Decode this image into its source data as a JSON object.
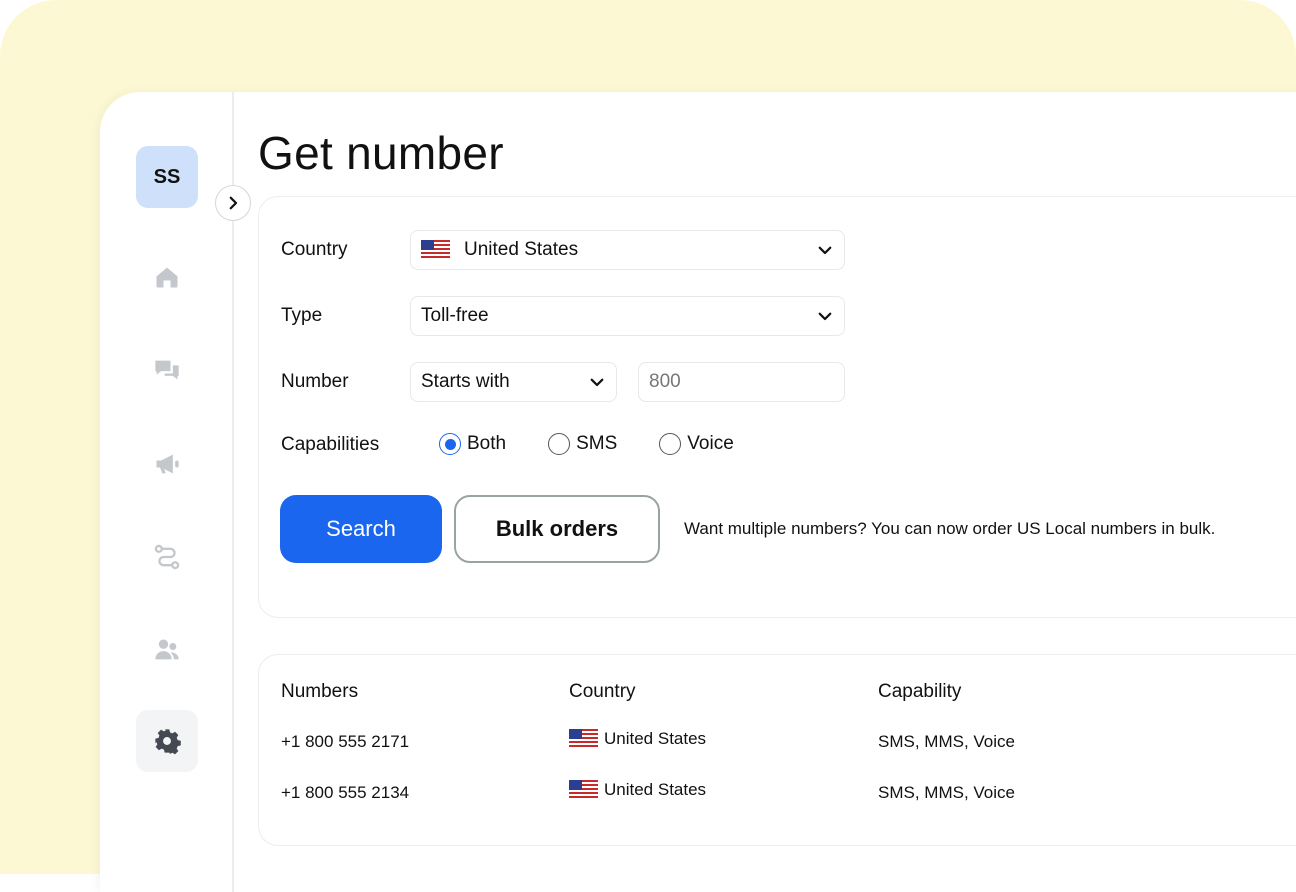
{
  "sidebar": {
    "avatar_initials": "SS",
    "items": [
      {
        "name": "home",
        "icon": "home-icon"
      },
      {
        "name": "messages",
        "icon": "chat-icon"
      },
      {
        "name": "campaigns",
        "icon": "megaphone-icon"
      },
      {
        "name": "flows",
        "icon": "flow-icon"
      },
      {
        "name": "contacts",
        "icon": "contacts-icon"
      },
      {
        "name": "settings",
        "icon": "gear-icon",
        "active": true
      }
    ]
  },
  "page": {
    "title": "Get number"
  },
  "form": {
    "country_label": "Country",
    "country_value": "United States",
    "type_label": "Type",
    "type_value": "Toll-free",
    "number_label": "Number",
    "number_match_value": "Starts with",
    "number_input_value": "800",
    "capabilities_label": "Capabilities",
    "capabilities": [
      {
        "label": "Both",
        "selected": true
      },
      {
        "label": "SMS",
        "selected": false
      },
      {
        "label": "Voice",
        "selected": false
      }
    ],
    "search_button": "Search",
    "bulk_button": "Bulk orders",
    "bulk_note": "Want multiple numbers? You can now order US Local numbers in bulk."
  },
  "results": {
    "columns": [
      "Numbers",
      "Country",
      "Capability"
    ],
    "rows": [
      {
        "number": "+1 800 555 2171",
        "country": "United States",
        "capability": "SMS, MMS, Voice"
      },
      {
        "number": "+1 800 555 2134",
        "country": "United States",
        "capability": "SMS, MMS, Voice"
      }
    ]
  },
  "colors": {
    "accent": "#1a66ee",
    "backdrop": "#fdf8d4",
    "avatar_bg": "#cfe0fb",
    "nav_icon": "#c4c7cc"
  }
}
